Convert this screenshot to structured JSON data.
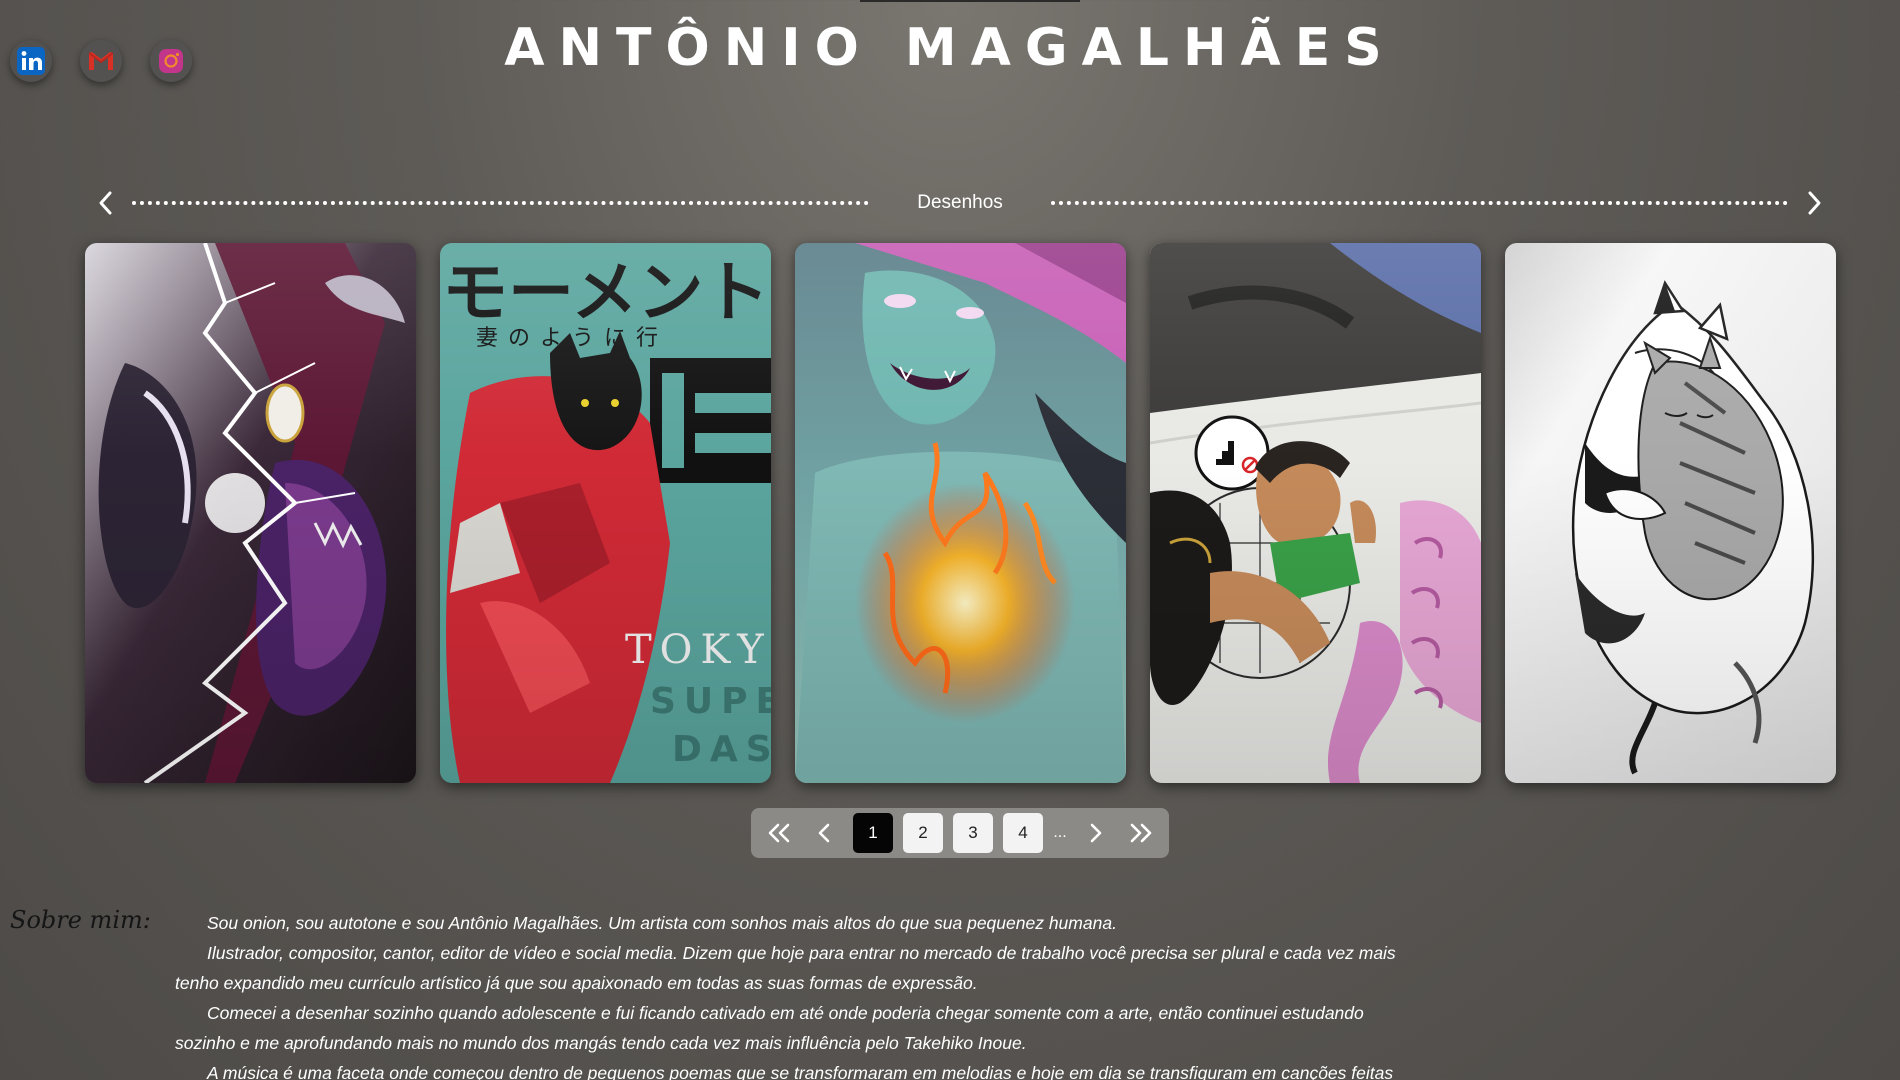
{
  "header": {
    "title": "ANTÔNIO MAGALHÃES"
  },
  "socials": [
    {
      "name": "LinkedIn",
      "icon": "linkedin-icon",
      "color": "#0a66c2"
    },
    {
      "name": "Gmail",
      "icon": "gmail-icon",
      "color": "#d93025"
    },
    {
      "name": "Instagram",
      "icon": "instagram-icon",
      "color": "#c1358a"
    }
  ],
  "gallery": {
    "section_label": "Desenhos",
    "prev_icon": "chevron-left-icon",
    "next_icon": "chevron-right-icon",
    "artworks": [
      {
        "id": "artwork-1",
        "subject": "lightning-warrior",
        "palette": [
          "#241a2c",
          "#6b1b3c",
          "#e6e0f0"
        ]
      },
      {
        "id": "artwork-2",
        "subject": "cat-mecha-poster",
        "palette": [
          "#5aa59e",
          "#d02a36",
          "#151515"
        ],
        "text_lines": [
          "モーメント",
          "妻のように行",
          "TOKYO",
          "SUPE",
          "DASI"
        ]
      },
      {
        "id": "artwork-3",
        "subject": "fire-girl",
        "palette": [
          "#6fa8a6",
          "#c85fb6",
          "#f6b42a"
        ]
      },
      {
        "id": "artwork-4",
        "subject": "boy-sticker-scene",
        "palette": [
          "#3b3a38",
          "#e9e9e6",
          "#d97fbf"
        ]
      },
      {
        "id": "artwork-5",
        "subject": "sleeping-cats-sketch",
        "palette": [
          "#eeeeee",
          "#1a1a1a",
          "#9a9a9a"
        ]
      }
    ]
  },
  "pagination": {
    "first_icon": "double-chevron-left-icon",
    "prev_icon": "chevron-left-icon",
    "pages": [
      "1",
      "2",
      "3",
      "4"
    ],
    "current": "1",
    "ellipsis": "...",
    "next_icon": "chevron-right-icon",
    "last_icon": "double-chevron-right-icon"
  },
  "about": {
    "title": "Sobre mim:",
    "paragraphs": [
      "Sou onion, sou autotone e sou Antônio Magalhães. Um artista com sonhos mais altos do que sua pequenez humana.",
      "Ilustrador, compositor, cantor, editor de vídeo e social media. Dizem que hoje para entrar no mercado de trabalho você precisa ser plural e cada vez mais tenho expandido meu currículo artístico já que sou apaixonado em todas as suas formas de expressão.",
      "Comecei a desenhar sozinho quando adolescente e fui ficando cativado em até onde poderia chegar somente com a arte, então continuei estudando sozinho e me aprofundando mais no mundo dos mangás tendo cada vez mais influência pelo Takehiko Inoue.",
      "A música é uma faceta onde começou dentro de pequenos poemas que se transformaram em melodias e hoje em dia se transfiguram em canções feitas pelo"
    ]
  }
}
